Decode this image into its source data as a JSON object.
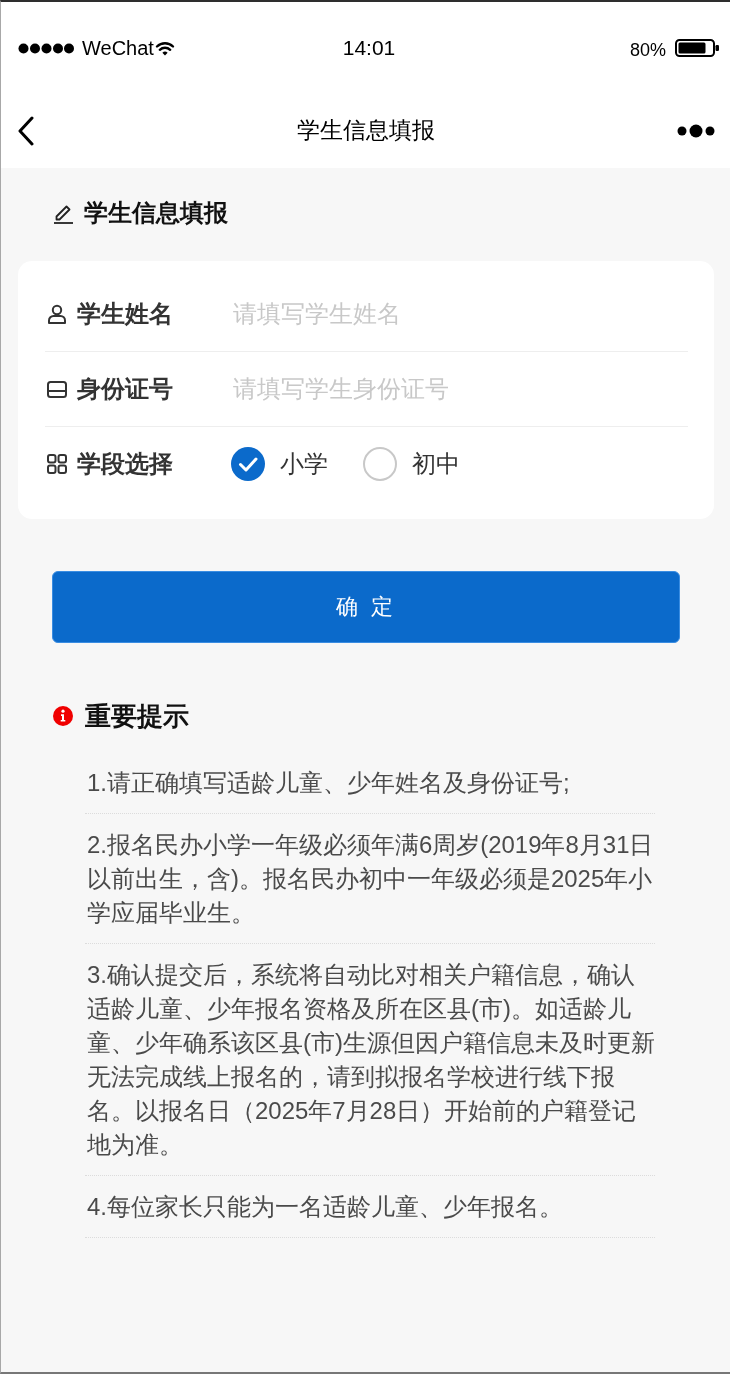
{
  "status_bar": {
    "carrier": "WeChat",
    "time": "14:01",
    "battery": "80%"
  },
  "nav_bar": {
    "title": "学生信息填报"
  },
  "section": {
    "title": "学生信息填报"
  },
  "form": {
    "fields": [
      {
        "kind": "text",
        "label": "学生姓名",
        "placeholder": "请填写学生姓名"
      },
      {
        "kind": "text",
        "label": "身份证号",
        "placeholder": "请填写学生身份证号"
      },
      {
        "kind": "radio",
        "label": "学段选择",
        "options": [
          {
            "label": "小学",
            "selected": true
          },
          {
            "label": "初中",
            "selected": false
          }
        ]
      }
    ]
  },
  "submit_button": "确 定",
  "notice": {
    "title": "重要提示",
    "items": [
      "1.请正确填写适龄儿童、少年姓名及身份证号;",
      "2.报名民办小学一年级必须年满6周岁(2019年8月31日以前出生，含)。报名民办初中一年级必须是2025年小学应届毕业生。",
      "3.确认提交后，系统将自动比对相关户籍信息，确认适龄儿童、少年报名资格及所在区县(市)。如适龄儿童、少年确系该区县(市)生源但因户籍信息未及时更新无法完成线上报名的，请到拟报名学校进行线下报名。以报名日（2025年7月28日）开始前的户籍登记地为准。",
      "4.每位家长只能为一名适龄儿童、少年报名。"
    ]
  }
}
